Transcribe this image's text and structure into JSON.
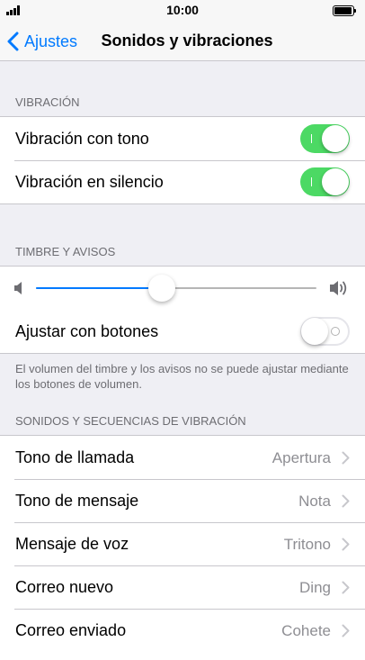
{
  "status_bar": {
    "time": "10:00",
    "signal_bars": 4,
    "battery_level": 1.0
  },
  "nav": {
    "back_label": "Ajustes",
    "title": "Sonidos y vibraciones"
  },
  "vibration": {
    "header": "VIBRACIÓN",
    "rows": [
      {
        "label": "Vibración con tono",
        "on": true
      },
      {
        "label": "Vibración en silencio",
        "on": true
      }
    ]
  },
  "ringer": {
    "header": "TIMBRE Y AVISOS",
    "volume_level": 0.45,
    "adjust_label": "Ajustar con botones",
    "adjust_on": false,
    "note": "El volumen del timbre y los avisos no se puede ajustar mediante los botones de volumen."
  },
  "sounds": {
    "header": "SONIDOS Y SECUENCIAS DE VIBRACIÓN",
    "rows": [
      {
        "label": "Tono de llamada",
        "value": "Apertura"
      },
      {
        "label": "Tono de mensaje",
        "value": "Nota"
      },
      {
        "label": "Mensaje de voz",
        "value": "Tritono"
      },
      {
        "label": "Correo nuevo",
        "value": "Ding"
      },
      {
        "label": "Correo enviado",
        "value": "Cohete"
      }
    ]
  },
  "colors": {
    "accent": "#007aff",
    "switch_on": "#4cd964",
    "background": "#efeff4"
  }
}
